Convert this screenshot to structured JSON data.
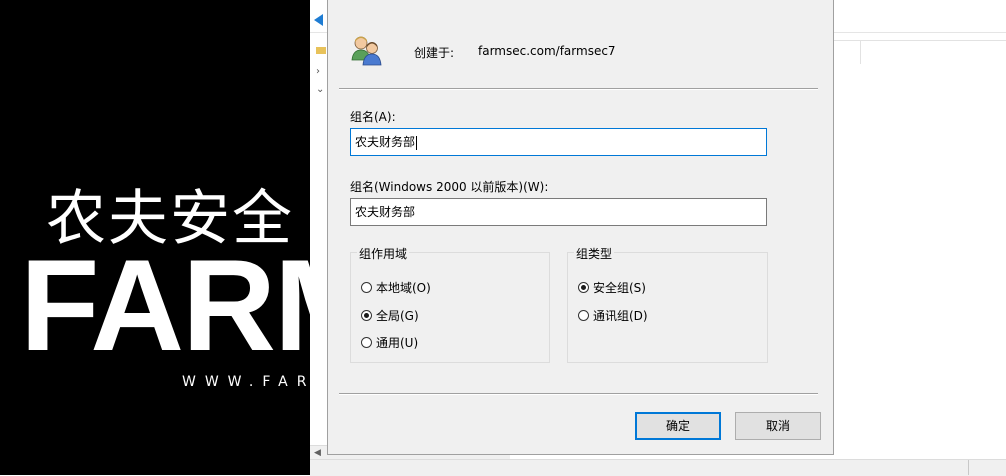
{
  "brand": {
    "cn_text": "农夫安全",
    "en_text": "FARM",
    "url_text": "WWW.FAR"
  },
  "dialog": {
    "created_in_label": "创建于:",
    "created_in_value": "farmsec.com/farmsec7",
    "group_name_label": "组名(A):",
    "group_name_value": "农夫财务部",
    "group_name_pre2000_label": "组名(Windows 2000 以前版本)(W):",
    "group_name_pre2000_value": "农夫财务部",
    "group_scope": {
      "title": "组作用域",
      "options": [
        {
          "label": "本地域(O)",
          "checked": false
        },
        {
          "label": "全局(G)",
          "checked": true
        },
        {
          "label": "通用(U)",
          "checked": false
        }
      ]
    },
    "group_type": {
      "title": "组类型",
      "options": [
        {
          "label": "安全组(S)",
          "checked": true
        },
        {
          "label": "通讯组(D)",
          "checked": false
        }
      ]
    },
    "ok_label": "确定",
    "cancel_label": "取消"
  },
  "colors": {
    "accent": "#0078d7",
    "dialog_bg": "#f0f0f0"
  },
  "icons": [
    "users-group-icon",
    "back-arrow-icon",
    "scroll-left-icon"
  ]
}
